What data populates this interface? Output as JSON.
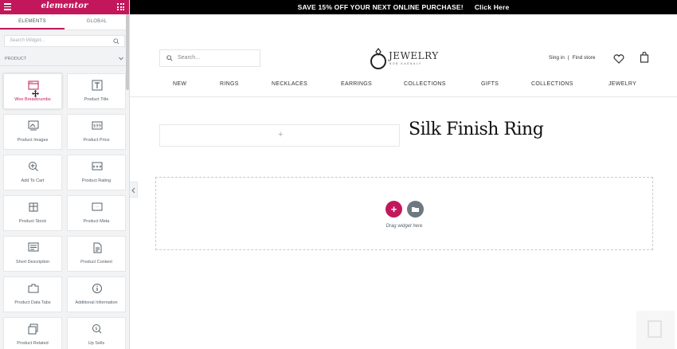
{
  "panel": {
    "logo": "elementor",
    "tabs": [
      {
        "label": "ELEMENTS",
        "active": true
      },
      {
        "label": "GLOBAL",
        "active": false
      }
    ],
    "search_placeholder": "Search Widget...",
    "section": "PRODUCT",
    "widgets": [
      {
        "label": "Woo Breadcrumbs",
        "icon": "breadcrumbs-icon"
      },
      {
        "label": "Product Title",
        "icon": "title-icon"
      },
      {
        "label": "Product Images",
        "icon": "images-icon"
      },
      {
        "label": "Product Price",
        "icon": "price-icon"
      },
      {
        "label": "Add To Cart",
        "icon": "add-to-cart-icon"
      },
      {
        "label": "Product Rating",
        "icon": "rating-icon"
      },
      {
        "label": "Product Stock",
        "icon": "stock-icon"
      },
      {
        "label": "Product Meta",
        "icon": "meta-icon"
      },
      {
        "label": "Short Description",
        "icon": "short-description-icon"
      },
      {
        "label": "Product Content",
        "icon": "content-icon"
      },
      {
        "label": "Product Data Tabs",
        "icon": "data-tabs-icon"
      },
      {
        "label": "Additional Information",
        "icon": "info-icon"
      },
      {
        "label": "Product Related",
        "icon": "related-icon"
      },
      {
        "label": "Up Sells",
        "icon": "upsells-icon"
      }
    ]
  },
  "site": {
    "promo": "SAVE 15% OFF YOUR NEXT ONLINE PURCHASE!",
    "promo_cta": "Click Here",
    "search_placeholder": "Search...",
    "brand_name": "JEWELRY",
    "brand_sub": "BOB KASNALY",
    "signin": "Sing in",
    "findstore": "Find store",
    "nav": [
      "NEW",
      "RINGS",
      "NECKLACES",
      "EARRINGS",
      "COLLECTIONS",
      "GIFTS",
      "COLLECTIONS",
      "JEWELRY"
    ],
    "product_title": "Silk Finish Ring",
    "drop_text": "Drag widget here"
  },
  "colors": {
    "accent": "#c2185b",
    "grey_button": "#6d7882"
  }
}
